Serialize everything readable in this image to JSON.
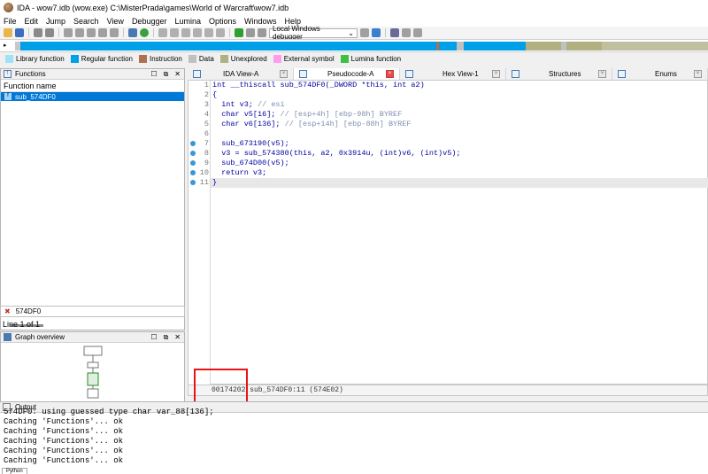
{
  "window": {
    "title": "IDA - wow7.idb (wow.exe) C:\\MisterPrada\\games\\World of Warcraft\\wow7.idb"
  },
  "menu": [
    "File",
    "Edit",
    "Jump",
    "Search",
    "View",
    "Debugger",
    "Lumina",
    "Options",
    "Windows",
    "Help"
  ],
  "toolbar": {
    "debugger_select": "Local Windows debugger"
  },
  "legend": [
    {
      "label": "Library function",
      "color": "#a0e0f8"
    },
    {
      "label": "Regular function",
      "color": "#00a0e8"
    },
    {
      "label": "Instruction",
      "color": "#b07050"
    },
    {
      "label": "Data",
      "color": "#c0c0c0"
    },
    {
      "label": "Unexplored",
      "color": "#b0b080"
    },
    {
      "label": "External symbol",
      "color": "#ff9cf0"
    },
    {
      "label": "Lumina function",
      "color": "#40c040"
    }
  ],
  "functions_panel": {
    "title": "Functions",
    "column_header": "Function name",
    "items": [
      "sub_574DF0"
    ],
    "filter_value": "574DF0",
    "line_info": "Line 1 of 1"
  },
  "graph_panel": {
    "title": "Graph overview"
  },
  "tabs": [
    {
      "label": "IDA View-A",
      "active": false
    },
    {
      "label": "Pseudocode-A",
      "active": true
    },
    {
      "label": "Hex View-1",
      "active": false
    },
    {
      "label": "Structures",
      "active": false
    },
    {
      "label": "Enums",
      "active": false
    }
  ],
  "code": [
    {
      "n": "1",
      "text": "int __thiscall sub_574DF0(_DWORD *this, int a2)",
      "dot": false
    },
    {
      "n": "2",
      "text": "{",
      "dot": false
    },
    {
      "n": "3",
      "text": "  int v3; // esi",
      "dot": false
    },
    {
      "n": "4",
      "text": "  char v5[16]; // [esp+4h] [ebp-98h] BYREF",
      "dot": false
    },
    {
      "n": "5",
      "text": "  char v6[136]; // [esp+14h] [ebp-88h] BYREF",
      "dot": false
    },
    {
      "n": "6",
      "text": "",
      "dot": false
    },
    {
      "n": "7",
      "text": "  sub_673190(v5);",
      "dot": true
    },
    {
      "n": "8",
      "text": "  v3 = sub_574380(this, a2, 0x3914u, (int)v6, (int)v5);",
      "dot": true
    },
    {
      "n": "9",
      "text": "  sub_674D00(v5);",
      "dot": true
    },
    {
      "n": "10",
      "text": "  return v3;",
      "dot": true
    },
    {
      "n": "11",
      "text": "}",
      "dot": true
    }
  ],
  "address_bar": "00174202 sub_574DF0:11 (574E02)",
  "output_panel": {
    "title": "Output",
    "lines": [
      "574DF0: using guessed type char var_88[136];",
      "Caching 'Functions'... ok",
      "Caching 'Functions'... ok",
      "Caching 'Functions'... ok",
      "Caching 'Functions'... ok",
      "Caching 'Functions'... ok"
    ],
    "python_tab": "Python"
  }
}
